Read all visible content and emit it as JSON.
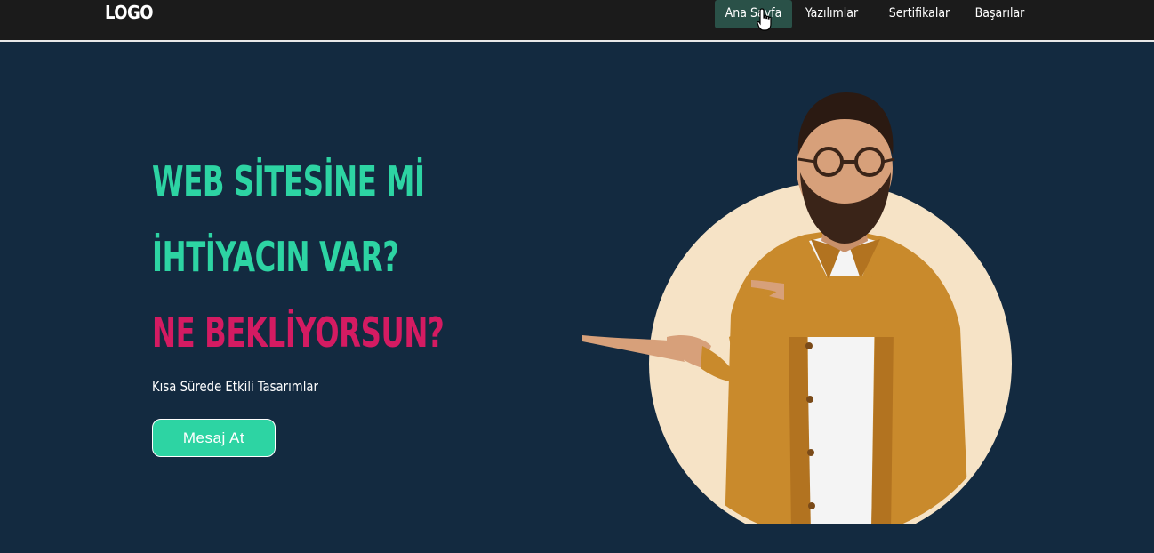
{
  "nav": {
    "logo": "LOGO",
    "items": [
      {
        "label": "Ana Sayfa",
        "active": true
      },
      {
        "label": "Yazılımlar",
        "active": false
      },
      {
        "label": "Sertifikalar",
        "active": false
      },
      {
        "label": "Başarılar",
        "active": false
      }
    ]
  },
  "hero": {
    "line1": "WEB SİTESİNE Mİ",
    "line2": "İHTİYACIN VAR?",
    "line3": "NE BEKLİYORSUN?",
    "subtitle": "Kısa Sürede Etkili Tasarımlar",
    "cta_label": "Mesaj At"
  },
  "colors": {
    "background": "#132a40",
    "navbar": "#1b1b1b",
    "accent_teal": "#2dd4a3",
    "accent_pink": "#d41b62",
    "nav_active": "#2a5148",
    "circle": "#f6e3c6",
    "jacket": "#c98a2c"
  },
  "icons": [
    "hand-pointer-cursor-icon"
  ]
}
